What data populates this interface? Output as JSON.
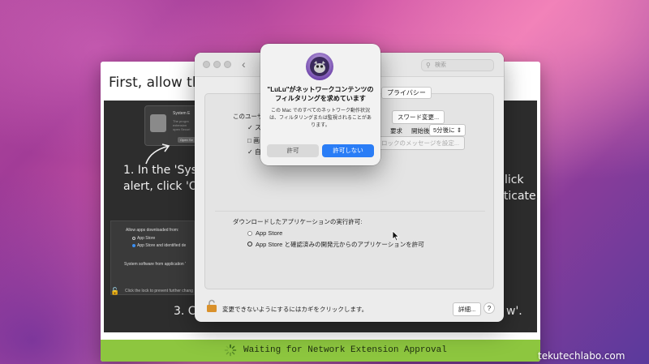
{
  "installer": {
    "heading": "First,  allow the Lu",
    "chalk_step1_line1": "1. In the 'Syst",
    "chalk_step1_line2": "alert, click 'Op",
    "chalk_right_line1": "lick",
    "chalk_right_line2": "uticate.",
    "chalk_step3": "3. Cli",
    "chalk_step3_end": "w'.",
    "thumb1_title": "System E",
    "thumb1_body": "The progra\nextension\nopen Securi",
    "thumb1_button": "Open Se",
    "thumb2_label": "Allow apps downloaded from:",
    "thumb2_opt1": "App Store",
    "thumb2_opt2": "App Store and identified de",
    "thumb2_footer": "System software from application '",
    "lock_text": "Click the lock to prevent further chang",
    "status": "Waiting for Network Extension Approval",
    "status_color": "#8dc63f"
  },
  "prefs": {
    "search_placeholder": "検索",
    "tab_privacy": "プライバシー",
    "user_label": "このユーザ",
    "checkbox_1": "ス",
    "checkbox_2": "画",
    "checkbox_3": "自",
    "change_password": "スワード変更...",
    "require_label": "要求",
    "start_label": "開始後:",
    "delay_value": "5分後に",
    "lock_message_button": "ロックのメッセージを設定...",
    "download_label": "ダウンロードしたアプリケーションの実行許可:",
    "option_app_store": "App Store",
    "option_identified": "App Store と確認済みの開発元からのアプリケーションを許可",
    "lock_footer": "変更できないようにするにはカギをクリックします。",
    "details_button": "詳細...",
    "help_button": "?"
  },
  "alert": {
    "title": "\"LuLu\"がネットワークコンテンツのフィルタリングを求めています",
    "body": "この Mac でのすべてのネットワーク動作状況は、フィルタリングまたは監視されることがあります。",
    "allow_button": "許可",
    "deny_button": "許可しない",
    "deny_color": "#2a7df6"
  },
  "watermark": "tekutechlabo.com"
}
